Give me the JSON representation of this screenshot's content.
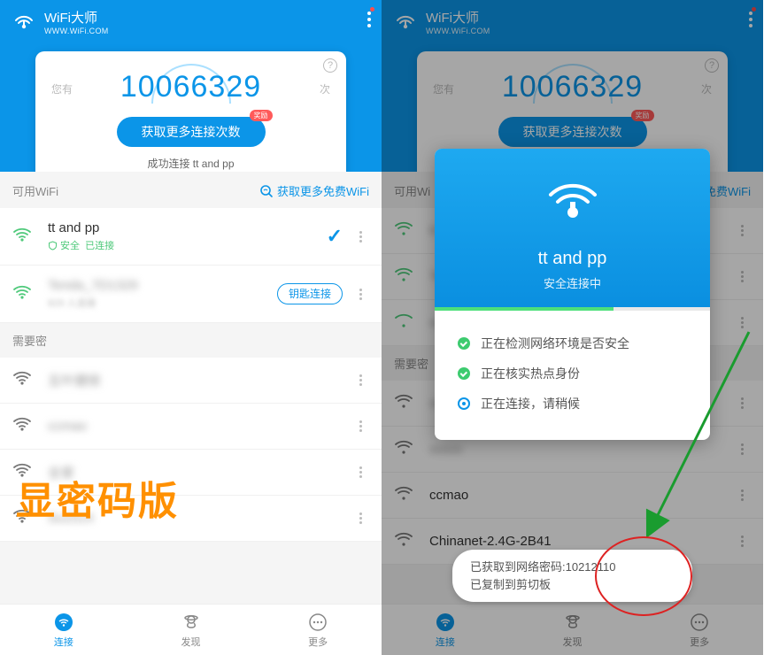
{
  "header": {
    "title": "WiFi大师",
    "url": "WWW.WiFi.COM"
  },
  "hero": {
    "side_left": "您有",
    "side_right": "次",
    "number": "10066329",
    "button": "获取更多连接次数",
    "badge": "奖励",
    "subtitle": "成功连接 tt and pp"
  },
  "sections": {
    "available": "可用WiFi",
    "more_free": "获取更多免费WiFi",
    "need_pwd": "需要密码",
    "need_pwd_cut": "需要密"
  },
  "wifi": {
    "available": [
      {
        "name": "tt and pp",
        "sub_safe": "安全",
        "sub_state": "已连接",
        "action": "check"
      },
      {
        "name": "Tenda_7D1329",
        "sub": "829 人连接",
        "action": "key"
      }
    ],
    "locked_left": [
      {
        "name": "五叶健侬"
      },
      {
        "name": "ccmao"
      },
      {
        "name": "全家"
      },
      {
        "name": "Su1514"
      }
    ],
    "locked_right": [
      {
        "name": "ccmao"
      },
      {
        "name": "Chinanet-2.4G-2B41"
      }
    ]
  },
  "key_button": "钥匙连接",
  "nav": {
    "connect": "连接",
    "discover": "发现",
    "more": "更多"
  },
  "overlay_left": "显密码版",
  "modal": {
    "ssid": "tt and pp",
    "status": "安全连接中",
    "steps": [
      {
        "text": "正在检测网络环境是否安全",
        "state": "done"
      },
      {
        "text": "正在核实热点身份",
        "state": "done"
      },
      {
        "text": "正在连接，请稍候",
        "state": "pending"
      }
    ]
  },
  "toast": {
    "line1": "已获取到网络密码:10212110",
    "line2": "已复制到剪切板"
  },
  "right_sect_available_cut": "可用Wi",
  "right_more_free_cut": "多免费WiFi"
}
